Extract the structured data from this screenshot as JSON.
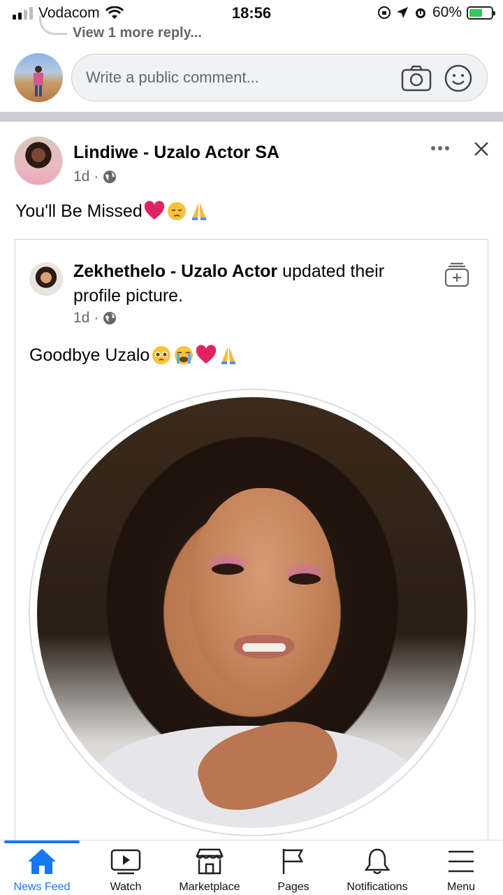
{
  "status_bar": {
    "carrier": "Vodacom",
    "time": "18:56",
    "battery_percent": "60%",
    "battery_level": 0.6,
    "signal_bars": 4,
    "signal_bars_active": 2
  },
  "comments": {
    "view_more_replies": "View 1 more reply...",
    "input_placeholder": "Write a public comment..."
  },
  "post": {
    "author": "Lindiwe - Uzalo Actor SA",
    "time": "1d",
    "separator": "·",
    "privacy_icon": "globe-icon",
    "text": "You'll Be Missed",
    "emojis": [
      "heart",
      "pensive",
      "pray"
    ],
    "shared": {
      "author": "Zekhethelo - Uzalo Actor",
      "action": " updated their profile picture.",
      "time": "1d",
      "separator": "·",
      "text": "Goodbye Uzalo",
      "emojis": [
        "pleading",
        "crying",
        "heart",
        "pray"
      ]
    }
  },
  "bottom_nav": {
    "items": [
      {
        "label": "News Feed",
        "icon": "home-icon",
        "active": true
      },
      {
        "label": "Watch",
        "icon": "video-icon",
        "active": false
      },
      {
        "label": "Marketplace",
        "icon": "store-icon",
        "active": false
      },
      {
        "label": "Pages",
        "icon": "flag-icon",
        "active": false
      },
      {
        "label": "Notifications",
        "icon": "bell-icon",
        "active": false
      },
      {
        "label": "Menu",
        "icon": "menu-icon",
        "active": false
      }
    ]
  },
  "colors": {
    "accent": "#1877f2",
    "secondary_text": "#65676b",
    "divider": "#c9ccd1",
    "heart": "#e0245e",
    "battery": "#34c759"
  }
}
